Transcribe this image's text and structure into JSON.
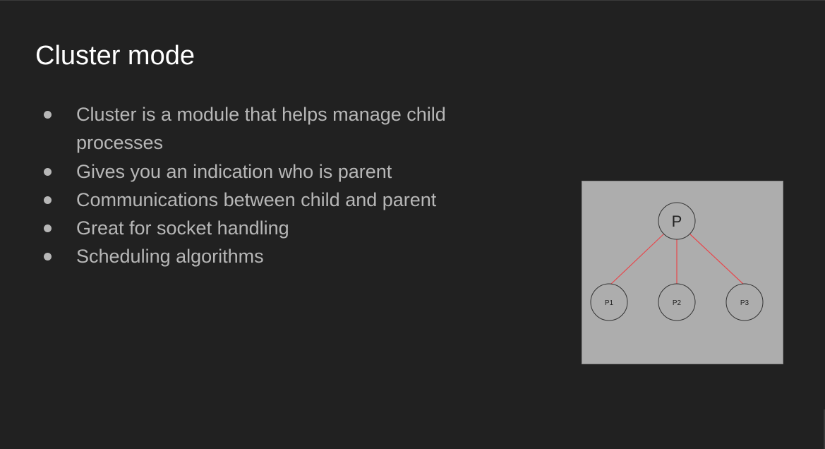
{
  "slide": {
    "title": "Cluster mode",
    "bullets": [
      "Cluster is a module that helps manage child processes",
      "Gives you an indication who is parent",
      "Communications between child and parent",
      "Great for socket handling",
      "Scheduling algorithms"
    ]
  },
  "diagram": {
    "parent": "P",
    "children": [
      "P1",
      "P2",
      "P3"
    ],
    "colors": {
      "background": "#adadad",
      "edge": "#e8474c",
      "node_stroke": "#333333"
    }
  }
}
